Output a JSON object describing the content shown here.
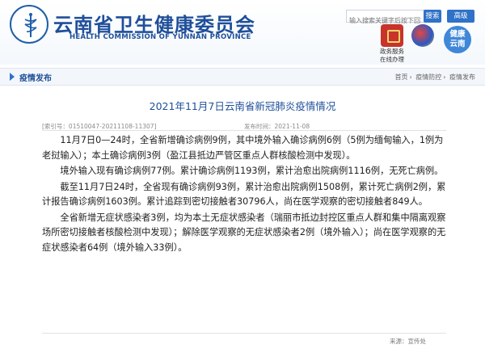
{
  "header": {
    "org_name_cn": "云南省卫生健康委员会",
    "org_name_en": "HEALTH COMMISSION OF YUNNAN PROVINCE",
    "search": {
      "placeholder": "输入搜索关键字后按下回车",
      "button": "搜索",
      "advanced_button": "高级"
    },
    "services": [
      {
        "name": "gov-service",
        "label_1": "政务服务",
        "label_2": "在线办理"
      },
      {
        "name": "app",
        "label_1": ""
      },
      {
        "name": "health-yunnan",
        "label_1": "健康",
        "label_2": "云南"
      }
    ]
  },
  "breadcrumb": {
    "section": "疫情发布",
    "items": [
      "首页",
      "疫情防控",
      "疫情发布"
    ],
    "separator": "›"
  },
  "article": {
    "title": "2021年11月7日云南省新冠肺炎疫情情况",
    "index_no": "[索引号：01510047-20211108-11307]",
    "publish_date": "发布时间：2021-11-08",
    "paragraphs": [
      "11月7日0—24时，全省新增确诊病例9例，其中境外输入确诊病例6例（5例为缅甸输入，1例为老挝输入）；本土确诊病例3例（盈江县抵边严管区重点人群核酸检测中发现）。",
      "境外输入现有确诊病例77例。累计确诊病例1193例，累计治愈出院病例1116例，无死亡病例。",
      "截至11月7日24时，全省现有确诊病例93例，累计治愈出院病例1508例，累计死亡病例2例，累计报告确诊病例1603例。累计追踪到密切接触者30796人，尚在医学观察的密切接触者849人。",
      "全省新增无症状感染者3例，均为本土无症状感染者（瑞丽市抵边封控区重点人群和集中隔离观察场所密切接触者核酸检测中发现）；解除医学观察的无症状感染者2例（境外输入）；尚在医学观察的无症状感染者64例（境外输入33例）。"
    ],
    "source": "来源：宣传处"
  },
  "colors": {
    "brand_blue": "#1f4f9a",
    "accent_blue": "#2f72c8",
    "bar_bg": "#f3f6fa"
  }
}
